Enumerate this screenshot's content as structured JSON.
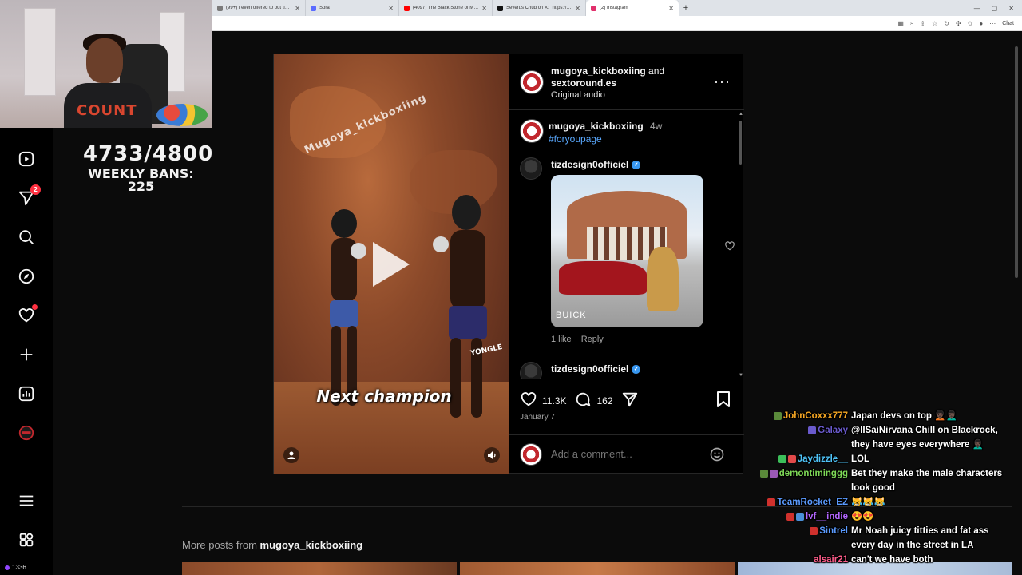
{
  "browser": {
    "tabs": [
      {
        "title": "(99+) I even offered to out tip 21 o",
        "color": "#7a7a7a",
        "active": false
      },
      {
        "title": "Sora",
        "color": "#5b6cff",
        "active": false
      },
      {
        "title": "(4097) The Black Stone of Mecca",
        "color": "#ff0000",
        "active": false
      },
      {
        "title": "Severus Chud on X: \"https://t.co/",
        "color": "#111111",
        "active": false
      },
      {
        "title": "(2) Instagram",
        "color": "#e1306c",
        "active": true
      }
    ],
    "new_tab": "+",
    "chat_button": "Chat"
  },
  "stream_overlay": {
    "ban_count": "4733/4800",
    "weekly_bans": "WEEKLY BANS: 225",
    "shirt_text": "COUNT",
    "viewer_count": "1336"
  },
  "sidebar": {
    "notifications_badge": "2",
    "items": [
      "reels-icon",
      "messages-icon",
      "search-icon",
      "explore-icon",
      "notifications-icon",
      "create-icon",
      "dashboard-icon",
      "profile-icon",
      "menu-icon",
      "threads-icon"
    ]
  },
  "post": {
    "video": {
      "watermark": "Mugoya_kickboxiing",
      "caption": "Next champion",
      "shorts_text": "YONGLE"
    },
    "header": {
      "user1": "mugoya_kickboxiing",
      "and": "and",
      "user2": "sextoround.es",
      "audio": "Original audio",
      "more": "···"
    },
    "caption": {
      "username": "mugoya_kickboxiing",
      "time": "4w",
      "hashtag": "#foryoupage"
    },
    "comments": [
      {
        "username": "tizdesign0officiel",
        "image_brand": "BUICK",
        "likes": "1 like",
        "reply": "Reply"
      },
      {
        "username": "tizdesign0officiel"
      }
    ],
    "actions": {
      "likes": "11.3K",
      "comments": "162",
      "date": "January 7"
    },
    "add_comment_placeholder": "Add a comment..."
  },
  "more_posts": {
    "label": "More posts from",
    "username": "mugoya_kickboxiing"
  },
  "chat": [
    {
      "user": "JohnCoxxx777",
      "color": "#f5a623",
      "text": "Japan devs on top 🧑🏿‍🦱👨🏿‍🦱"
    },
    {
      "user": "Galaxy",
      "color": "#6a5acd",
      "text": "@IISaiNirvana Chill on Blackrock, they have eyes everywhere 👨🏿‍🦱"
    },
    {
      "user": "Jaydizzle__",
      "color": "#4fc3f7",
      "text": "LOL"
    },
    {
      "user": "demontiminggg",
      "color": "#7ed957",
      "text": "Bet they make the male characters look good"
    },
    {
      "user": "TeamRocket_EZ",
      "color": "#5b9bff",
      "text": "😹😹😹"
    },
    {
      "user": "lvf__indie",
      "color": "#b366ff",
      "text": "😍😍"
    },
    {
      "user": "Sintrel",
      "color": "#5b9bff",
      "text": "Mr Noah juicy titties and fat ass every day in the street in LA"
    },
    {
      "user": "alsair21",
      "color": "#ff5c8a",
      "text": "can't we have both"
    }
  ]
}
